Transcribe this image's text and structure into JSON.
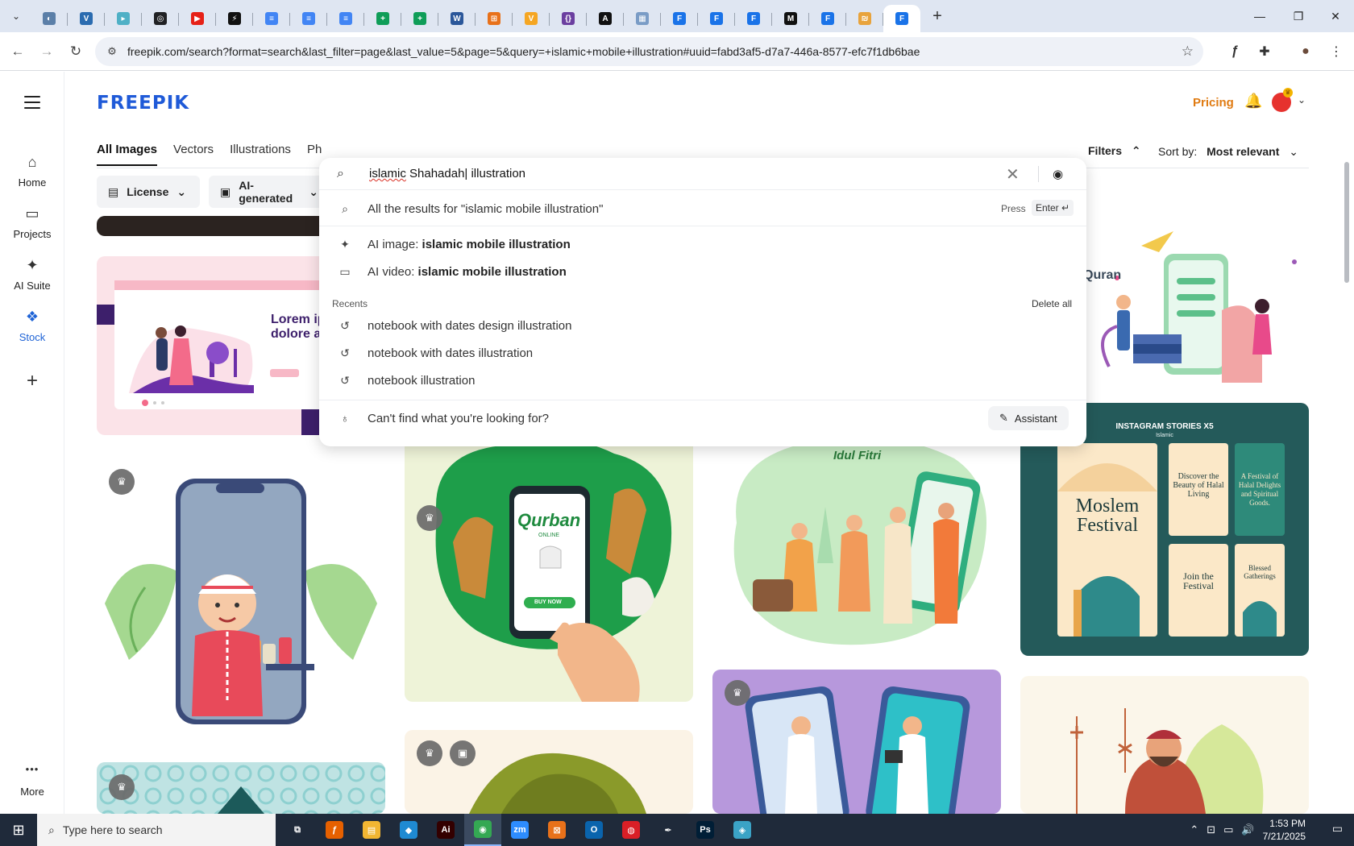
{
  "browser": {
    "tab_menu_icon": "chevron-down-icon",
    "tabs": [
      {
        "name": "tab-1",
        "color": "#5b7fa8",
        "glyph": "◐"
      },
      {
        "name": "tab-2",
        "color": "#2b6cb0",
        "glyph": "V"
      },
      {
        "name": "tab-3",
        "color": "#4fb0c6",
        "glyph": "▸"
      },
      {
        "name": "tab-4",
        "color": "#202124",
        "glyph": "◎"
      },
      {
        "name": "tab-5",
        "color": "#e62117",
        "glyph": "▶"
      },
      {
        "name": "tab-6",
        "color": "#111111",
        "glyph": "⚡"
      },
      {
        "name": "tab-7",
        "color": "#4285f4",
        "glyph": "≡"
      },
      {
        "name": "tab-8",
        "color": "#4285f4",
        "glyph": "≡"
      },
      {
        "name": "tab-9",
        "color": "#4285f4",
        "glyph": "≡"
      },
      {
        "name": "tab-10",
        "color": "#0f9d58",
        "glyph": "+"
      },
      {
        "name": "tab-11",
        "color": "#0f9d58",
        "glyph": "+"
      },
      {
        "name": "tab-12",
        "color": "#2b579a",
        "glyph": "W"
      },
      {
        "name": "tab-13",
        "color": "#e8711a",
        "glyph": "⊞"
      },
      {
        "name": "tab-14",
        "color": "#f5a623",
        "glyph": "V"
      },
      {
        "name": "tab-15",
        "color": "#6b3fa0",
        "glyph": "{}"
      },
      {
        "name": "tab-16",
        "color": "#111111",
        "glyph": "A"
      },
      {
        "name": "tab-17",
        "color": "#7a9cc6",
        "glyph": "▦"
      },
      {
        "name": "tab-18",
        "color": "#1a73e8",
        "glyph": "F"
      },
      {
        "name": "tab-19",
        "color": "#1a73e8",
        "glyph": "F"
      },
      {
        "name": "tab-20",
        "color": "#1a73e8",
        "glyph": "F"
      },
      {
        "name": "tab-21",
        "color": "#111111",
        "glyph": "M"
      },
      {
        "name": "tab-22",
        "color": "#1a73e8",
        "glyph": "F"
      },
      {
        "name": "tab-23",
        "color": "#e8a33c",
        "glyph": "₪"
      },
      {
        "name": "tab-24",
        "color": "#1a73e8",
        "glyph": "F"
      }
    ],
    "new_tab": "+",
    "window": {
      "minimize": "—",
      "restore": "❐",
      "close": "✕"
    },
    "url": "freepik.com/search?format=search&last_filter=page&last_value=5&page=5&query=+islamic+mobile+illustration#uuid=fabd3af5-d7a7-446a-8577-efc7f1db6bae",
    "nav": {
      "back": "←",
      "forward": "→",
      "reload": "↻",
      "tune": "⚙",
      "star": "☆"
    },
    "extensions": {
      "ext1": "ƒ",
      "ext2": "✚",
      "profile": "●",
      "menu": "⋮"
    }
  },
  "freepik": {
    "logo": "FREEPIK",
    "pricing": "Pricing",
    "bell": "🔔",
    "crown": "♛",
    "avatar_chevron": "⌄",
    "sidebar": [
      {
        "icon": "⌂",
        "label": "Home"
      },
      {
        "icon": "▭",
        "label": "Projects"
      },
      {
        "icon": "✦",
        "label": "AI Suite"
      },
      {
        "icon": "❖",
        "label": "Stock"
      },
      {
        "icon": "+",
        "label": ""
      },
      {
        "icon": "•••",
        "label": "More"
      }
    ],
    "filter_tabs": [
      "All Images",
      "Vectors",
      "Illustrations",
      "Ph"
    ],
    "filters_label": "Filters",
    "filters_chevron": "⌃",
    "sort": {
      "label": "Sort by:",
      "value": "Most relevant",
      "chevron": "⌄"
    },
    "pills": [
      {
        "icon": "▤",
        "label": "License",
        "chevron": "⌄"
      },
      {
        "icon": "▣",
        "label": "AI-generated",
        "chevron": "⌄"
      }
    ],
    "cards": {
      "lorem": "Lorem ip\ndolore a",
      "qurban": "Qurban",
      "qurban_sub": "ONLINE",
      "buy_now": "BUY NOW",
      "idul_fitri": "Idul Fitri",
      "quran": "E-Quran",
      "quran_pre": "n",
      "insta_title": "INSTAGRAM STORIES X5",
      "insta_sub": "Islamic",
      "moslem": "Moslem\nFestival",
      "discover": "Discover the Beauty of Halal Living",
      "festival_delights": "A Festival of Halal Delights and Spiritual Goods.",
      "join": "Join the Festival",
      "blessed": "Blessed Gatherings",
      "badge_glyph": "♛",
      "image_glyph": "▣"
    }
  },
  "search": {
    "query_misspelled": "islamic",
    "query_rest": " Shahadah| illustration",
    "all_results": "All the results for \"islamic mobile illustration\"",
    "press": "Press",
    "enter": "Enter ↵",
    "ai_image_prefix": "AI image: ",
    "ai_image_bold": "islamic mobile illustration",
    "ai_video_prefix": "AI video: ",
    "ai_video_bold": "islamic mobile illustration",
    "recents_header": "Recents",
    "delete_all": "Delete all",
    "recents": [
      "notebook with dates design illustration",
      "notebook with dates illustration",
      "notebook illustration"
    ],
    "cant_find": "Can't find what you're looking for?",
    "assistant": "Assistant",
    "icons": {
      "search": "⌕",
      "clear": "✕",
      "camera": "◉",
      "sparkle": "✦",
      "video": "▭",
      "history": "↺",
      "bulb": "♁",
      "assist": "✎"
    }
  },
  "taskbar": {
    "start": "⊞",
    "search_placeholder": "Type here to search",
    "search_icon": "⌕",
    "apps": [
      {
        "name": "task-view",
        "glyph": "⧉",
        "color": "#1f2a3a"
      },
      {
        "name": "firefox",
        "glyph": "ƒ",
        "color": "#e66000"
      },
      {
        "name": "file-explorer",
        "glyph": "▤",
        "color": "#f2b632"
      },
      {
        "name": "vscode",
        "glyph": "◆",
        "color": "#1f8ad2"
      },
      {
        "name": "illustrator",
        "glyph": "Ai",
        "color": "#330000"
      },
      {
        "name": "chrome",
        "glyph": "◉",
        "color": "#34a853"
      },
      {
        "name": "zoom",
        "glyph": "zm",
        "color": "#2d8cff"
      },
      {
        "name": "app-orange",
        "glyph": "⊠",
        "color": "#e8711a"
      },
      {
        "name": "outlook",
        "glyph": "O",
        "color": "#0a64ad"
      },
      {
        "name": "app-creative",
        "glyph": "◍",
        "color": "#da1f26"
      },
      {
        "name": "pen-tool",
        "glyph": "✒",
        "color": "#1f2a3a"
      },
      {
        "name": "photoshop",
        "glyph": "Ps",
        "color": "#001e36"
      },
      {
        "name": "app-blue",
        "glyph": "◈",
        "color": "#3ba3c6"
      }
    ],
    "tray": {
      "up": "⌃",
      "net": "⊡",
      "folder": "▭",
      "volume": "🔊"
    },
    "time": "1:53 PM",
    "date": "7/21/2025",
    "notifications": "▭"
  }
}
